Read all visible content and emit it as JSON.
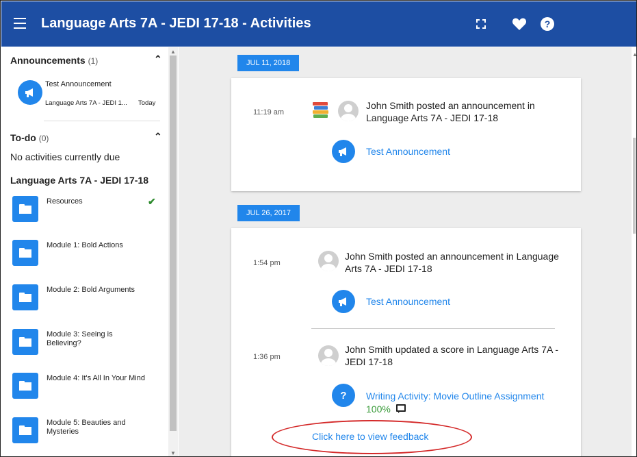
{
  "header": {
    "title": "Language Arts 7A - JEDI 17-18 - Activities",
    "icons": [
      "menu-icon",
      "fullscreen-icon",
      "heart-icon",
      "help-icon"
    ]
  },
  "sidebar": {
    "announcements": {
      "heading": "Announcements",
      "count": "(1)",
      "item": {
        "title": "Test Announcement",
        "course": "Language Arts 7A - JEDI 1...",
        "date": "Today"
      }
    },
    "todo": {
      "heading": "To-do",
      "count": "(0)",
      "empty_text": "No activities currently due"
    },
    "course": {
      "title": "Language Arts 7A - JEDI 17-18",
      "modules": [
        {
          "label": "Resources",
          "completed": true
        },
        {
          "label": "Module 1: Bold Actions",
          "completed": false
        },
        {
          "label": "Module 2: Bold Arguments",
          "completed": false
        },
        {
          "label": "Module 3: Seeing is Believing?",
          "completed": false
        },
        {
          "label": "Module 4: It's All In Your Mind",
          "completed": false
        },
        {
          "label": "Module 5: Beauties and Mysteries",
          "completed": false
        }
      ]
    }
  },
  "feed": {
    "groups": [
      {
        "date": "JUL 11, 2018",
        "entries": [
          {
            "time": "11:19 am",
            "text": "John Smith posted an announcement in Language Arts 7A - JEDI 17-18",
            "action": "Test Announcement"
          }
        ]
      },
      {
        "date": "JUL 26, 2017",
        "entries": [
          {
            "time": "1:54 pm",
            "text": "John Smith posted an announcement in Language Arts 7A - JEDI 17-18",
            "action": "Test Announcement"
          },
          {
            "time": "1:36 pm",
            "text": "John Smith updated a score in Language Arts 7A - JEDI 17-18",
            "action": "Writing Activity: Movie Outline Assignment",
            "score": "100%",
            "feedback_link": "Click here to view feedback"
          }
        ]
      }
    ]
  },
  "colors": {
    "header_bg": "#1d4ea3",
    "accent": "#2186eb",
    "score_green": "#3a9b3a",
    "highlight_red": "#d42a2a"
  }
}
